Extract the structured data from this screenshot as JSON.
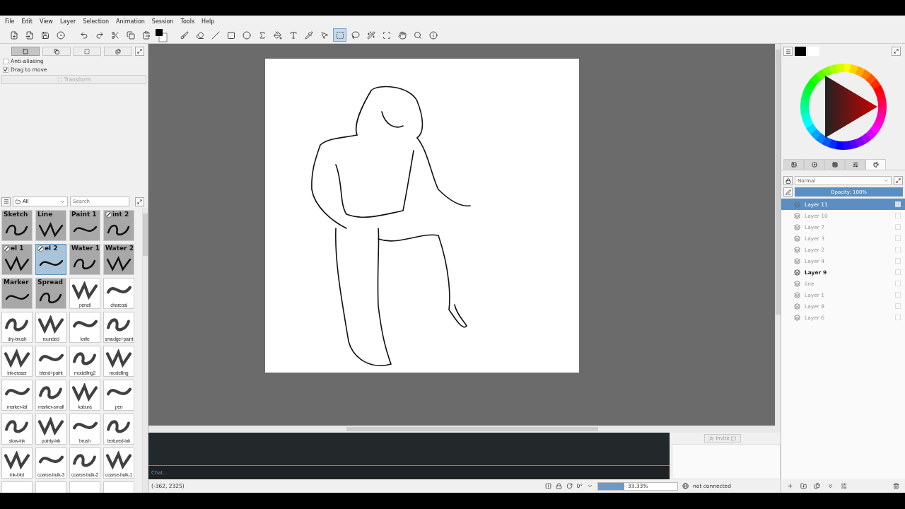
{
  "menu": [
    "File",
    "Edit",
    "View",
    "Layer",
    "Selection",
    "Animation",
    "Session",
    "Tools",
    "Help"
  ],
  "toolbar": [
    [
      {
        "kind": "new",
        "selected": false
      },
      {
        "kind": "open",
        "selected": false
      },
      {
        "kind": "save",
        "selected": false
      },
      {
        "kind": "record",
        "selected": false
      }
    ],
    [
      {
        "kind": "undo",
        "selected": false
      },
      {
        "kind": "redo",
        "selected": false
      },
      {
        "kind": "cut",
        "selected": false
      },
      {
        "kind": "copy",
        "selected": false
      },
      {
        "kind": "paste",
        "selected": false
      },
      {
        "kind": "colors",
        "selected": false
      }
    ],
    [
      {
        "kind": "brush",
        "selected": false
      },
      {
        "kind": "eraser",
        "selected": false
      },
      {
        "kind": "line",
        "selected": false
      },
      {
        "kind": "rect",
        "selected": false
      },
      {
        "kind": "ellipse",
        "selected": false
      },
      {
        "kind": "curve",
        "selected": false
      },
      {
        "kind": "fill",
        "selected": false
      },
      {
        "kind": "text",
        "selected": false
      },
      {
        "kind": "picker",
        "selected": false
      },
      {
        "kind": "pointer",
        "selected": false
      },
      {
        "kind": "select",
        "selected": true
      },
      {
        "kind": "lasso",
        "selected": false
      },
      {
        "kind": "wand",
        "selected": false
      },
      {
        "kind": "transform",
        "selected": false
      },
      {
        "kind": "pan",
        "selected": false
      },
      {
        "kind": "zoom",
        "selected": false
      },
      {
        "kind": "inspect",
        "selected": false
      }
    ]
  ],
  "tool_options": {
    "modes": [
      {
        "selected": true
      },
      {
        "selected": false
      },
      {
        "selected": false
      },
      {
        "selected": false
      }
    ],
    "options": [
      {
        "label": "Anti-aliasing",
        "checked": false
      },
      {
        "label": "Drag to move",
        "checked": true
      }
    ],
    "transform": {
      "label": "Transform",
      "disabled": true
    }
  },
  "brushes": {
    "filter": "All",
    "search_placeholder": "Search",
    "presets": [
      {
        "kind": "titled",
        "label": "Sketch",
        "badge": false,
        "selected": false
      },
      {
        "kind": "titled",
        "label": "Line",
        "badge": false,
        "selected": false
      },
      {
        "kind": "titled",
        "label": "Paint 1",
        "badge": false,
        "selected": false
      },
      {
        "kind": "titled",
        "label": "int 2",
        "badge": true,
        "selected": false
      },
      {
        "kind": "titled",
        "label": "el 1",
        "badge": true,
        "selected": false
      },
      {
        "kind": "titled",
        "label": "el 2",
        "badge": true,
        "selected": true
      },
      {
        "kind": "titled",
        "label": "Water 1",
        "badge": false,
        "selected": false
      },
      {
        "kind": "titled",
        "label": "Water 2",
        "badge": false,
        "selected": false
      },
      {
        "kind": "titled",
        "label": "Marker",
        "badge": false,
        "selected": false
      },
      {
        "kind": "titled",
        "label": "Spread",
        "badge": false,
        "selected": false
      },
      {
        "kind": "captioned",
        "label": "pencil",
        "selected": false
      },
      {
        "kind": "captioned",
        "label": "charcoal",
        "selected": false
      },
      {
        "kind": "captioned",
        "label": "dry-brush",
        "selected": false
      },
      {
        "kind": "captioned",
        "label": "rounded",
        "selected": false
      },
      {
        "kind": "captioned",
        "label": "knife",
        "selected": false
      },
      {
        "kind": "captioned",
        "label": "smudge+paint",
        "selected": false
      },
      {
        "kind": "captioned",
        "label": "ink-eraser",
        "selected": false
      },
      {
        "kind": "captioned",
        "label": "blend+paint",
        "selected": false
      },
      {
        "kind": "captioned",
        "label": "modelling2",
        "selected": false
      },
      {
        "kind": "captioned",
        "label": "modelling",
        "selected": false
      },
      {
        "kind": "captioned",
        "label": "marker-fat",
        "selected": false
      },
      {
        "kind": "captioned",
        "label": "marker-small",
        "selected": false
      },
      {
        "kind": "captioned",
        "label": "kabura",
        "selected": false
      },
      {
        "kind": "captioned",
        "label": "pen",
        "selected": false
      },
      {
        "kind": "captioned",
        "label": "slow-ink",
        "selected": false
      },
      {
        "kind": "captioned",
        "label": "pointy-ink",
        "selected": false
      },
      {
        "kind": "captioned",
        "label": "brush",
        "selected": false
      },
      {
        "kind": "captioned",
        "label": "textured-ink",
        "selected": false
      },
      {
        "kind": "captioned",
        "label": "ink-blot",
        "selected": false
      },
      {
        "kind": "captioned",
        "label": "coarse-bulk-3",
        "selected": false
      },
      {
        "kind": "captioned",
        "label": "coarse-bulk-2",
        "selected": false
      },
      {
        "kind": "captioned",
        "label": "coarse-bulk-1",
        "selected": false
      },
      {
        "kind": "blank",
        "selected": false
      },
      {
        "kind": "blank",
        "selected": false
      },
      {
        "kind": "blank",
        "selected": false
      },
      {
        "kind": "blank",
        "selected": false
      }
    ]
  },
  "color": {
    "tabs": [
      {
        "selected": false
      },
      {
        "selected": false
      },
      {
        "selected": false
      },
      {
        "selected": false
      },
      {
        "selected": true
      }
    ]
  },
  "layers": {
    "blend": "Normal",
    "opacity": {
      "label": "Opacity: 100%",
      "level": 1
    },
    "items": [
      {
        "name": "Layer 11",
        "selected": true,
        "visible": false
      },
      {
        "name": "Layer 10",
        "selected": false,
        "visible": false
      },
      {
        "name": "Layer 7",
        "selected": false,
        "visible": false
      },
      {
        "name": "Layer 3",
        "selected": false,
        "visible": false
      },
      {
        "name": "Layer 2",
        "selected": false,
        "visible": false
      },
      {
        "name": "Layer 4",
        "selected": false,
        "visible": false
      },
      {
        "name": "Layer 9",
        "selected": false,
        "visible": true
      },
      {
        "name": "line",
        "selected": false,
        "visible": false
      },
      {
        "name": "Layer 1",
        "selected": false,
        "visible": false
      },
      {
        "name": "Layer 8",
        "selected": false,
        "visible": false
      },
      {
        "name": "Layer 6",
        "selected": false,
        "visible": false
      }
    ]
  },
  "chat": {
    "placeholder": "Chat..."
  },
  "users": {
    "invite": "Invite"
  },
  "status": {
    "coords": "(-362, 2325)",
    "rotation": "0°",
    "zoom": {
      "label": "33.33%",
      "level": 0.33
    },
    "connection": "not connected"
  }
}
